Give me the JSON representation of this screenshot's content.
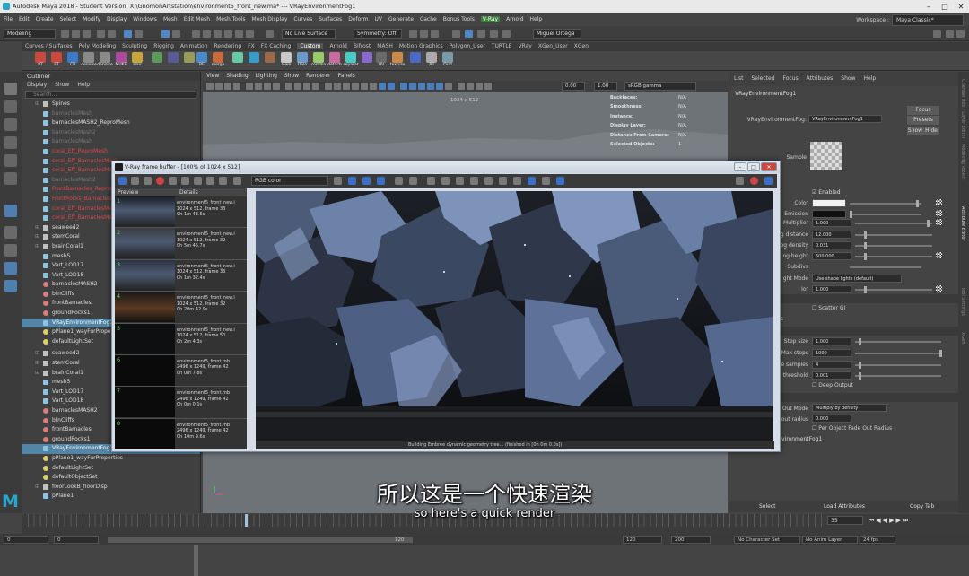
{
  "window": {
    "title": "Autodesk Maya 2018 - Student Version: X:\\GnomonArtstation\\environment5_front_new.ma* --- VRayEnvironmentFog1",
    "controls": [
      "–",
      "□",
      "✕"
    ]
  },
  "menubar": {
    "items": [
      "File",
      "Edit",
      "Create",
      "Select",
      "Modify",
      "Display",
      "Windows",
      "Mesh",
      "Edit Mesh",
      "Mesh Tools",
      "Mesh Display",
      "Curves",
      "Surfaces",
      "Deform",
      "UV",
      "Generate",
      "Cache",
      "Bonus Tools",
      "V-Ray",
      "Arnold",
      "Help"
    ],
    "workspace_label": "Workspace :",
    "workspace_value": "Maya Classic*"
  },
  "statusline": {
    "mode": "Modeling",
    "live_surface": "No Live Surface",
    "symmetry": "Symmetry: Off",
    "user": "Miguel Ortega"
  },
  "shelf": {
    "tabs": [
      "Curves / Surfaces",
      "Poly Modeling",
      "Sculpting",
      "Rigging",
      "Animation",
      "Rendering",
      "FX",
      "FX Caching",
      "Custom",
      "Arnold",
      "Bifrost",
      "MASH",
      "Motion Graphics",
      "Polygon_User",
      "TURTLE",
      "VRay",
      "XGen_User",
      "XGen"
    ],
    "active_tab": "Custom",
    "buttons": [
      "RT",
      "FT",
      "CP",
      "denoise",
      "denoise",
      "MUKE",
      "Hair",
      "",
      "",
      "",
      "BE",
      "merge",
      "",
      "",
      "",
      "lowe",
      "DSlo",
      "combin",
      "detach",
      "separat",
      "",
      "UV",
      "texture",
      "",
      "All",
      "Outl"
    ]
  },
  "outliner": {
    "title": "Outliner",
    "menu": [
      "Display",
      "Show",
      "Help"
    ],
    "search_placeholder": "Search...",
    "items": [
      {
        "label": "Spines",
        "style": "normal",
        "icon": "grp"
      },
      {
        "label": "barnaclesMash",
        "style": "dim",
        "icon": "mesh"
      },
      {
        "label": "barnaclesMASH2_ReproMesh",
        "style": "normal",
        "icon": "mesh"
      },
      {
        "label": "barnaclesMash2",
        "style": "dim",
        "icon": "mesh"
      },
      {
        "label": "barnaclesMash",
        "style": "dim",
        "icon": "mesh"
      },
      {
        "label": "coral_Eff_ReproMesh",
        "style": "red",
        "icon": "mesh"
      },
      {
        "label": "coral_Eff_BarnaclesMash",
        "style": "red",
        "icon": "mesh"
      },
      {
        "label": "coral_Eff_BarnaclesMash",
        "style": "red",
        "icon": "mesh"
      },
      {
        "label": "barnaclesMash2",
        "style": "dim",
        "icon": "mesh"
      },
      {
        "label": "FrontBarnacles_ReproMesh",
        "style": "red",
        "icon": "mesh"
      },
      {
        "label": "FrontRocks_BarnaclesMesh",
        "style": "red",
        "icon": "mesh"
      },
      {
        "label": "coral_Eff_BarnaclesMesh",
        "style": "red",
        "icon": "mesh"
      },
      {
        "label": "coral_Eff_BarnaclesMesh",
        "style": "red",
        "icon": "mesh"
      },
      {
        "label": "seaweed2",
        "style": "normal",
        "icon": "grp"
      },
      {
        "label": "stemCoral",
        "style": "normal",
        "icon": "grp"
      },
      {
        "label": "brainCoral1",
        "style": "normal",
        "icon": "grp"
      },
      {
        "label": "mesh5",
        "style": "normal",
        "icon": "mesh"
      },
      {
        "label": "Vart_LOD17",
        "style": "normal",
        "icon": "mesh"
      },
      {
        "label": "Vart_LOD18",
        "style": "normal",
        "icon": "mesh"
      },
      {
        "label": "barnaclesMASH2",
        "style": "normal",
        "icon": "sg"
      },
      {
        "label": "btnCliffs",
        "style": "normal",
        "icon": "sg"
      },
      {
        "label": "frontBarnacles",
        "style": "normal",
        "icon": "sg"
      },
      {
        "label": "groundRocks1",
        "style": "normal",
        "icon": "sg"
      },
      {
        "label": "VRayEnvironmentFog1",
        "style": "sel",
        "icon": "mesh"
      },
      {
        "label": "pPlane1_wayFurPropertie",
        "style": "normal",
        "icon": "light"
      },
      {
        "label": "defaultLightSet",
        "style": "normal",
        "icon": "light"
      }
    ],
    "items2": [
      {
        "label": "seaweed2",
        "style": "normal",
        "icon": "grp"
      },
      {
        "label": "stemCoral",
        "style": "normal",
        "icon": "grp"
      },
      {
        "label": "brainCoral1",
        "style": "normal",
        "icon": "grp"
      },
      {
        "label": "mesh5",
        "style": "normal",
        "icon": "mesh"
      },
      {
        "label": "Vart_LOD17",
        "style": "normal",
        "icon": "mesh"
      },
      {
        "label": "Vart_LOD18",
        "style": "normal",
        "icon": "mesh"
      },
      {
        "label": "barnaclesMASH2",
        "style": "normal",
        "icon": "sg"
      },
      {
        "label": "btnCliffs",
        "style": "normal",
        "icon": "sg"
      },
      {
        "label": "frontBarnacles",
        "style": "normal",
        "icon": "sg"
      },
      {
        "label": "groundRocks1",
        "style": "normal",
        "icon": "sg"
      },
      {
        "label": "VRayEnvironmentFog1",
        "style": "sel",
        "icon": "mesh"
      },
      {
        "label": "pPlane1_wayFurProperties",
        "style": "normal",
        "icon": "light"
      },
      {
        "label": "defaultLightSet",
        "style": "normal",
        "icon": "light"
      },
      {
        "label": "defaultObjectSet",
        "style": "normal",
        "icon": "light"
      },
      {
        "label": "floorLookB_floorDisp",
        "style": "normal",
        "icon": "grp"
      },
      {
        "label": "pPlane1",
        "style": "normal",
        "icon": "mesh"
      }
    ]
  },
  "viewport": {
    "menu": [
      "View",
      "Shading",
      "Lighting",
      "Show",
      "Renderer",
      "Panels"
    ],
    "field1": "0.00",
    "field2": "1.00",
    "colorspace": "sRGB gamma",
    "resolution": "1024 x 512",
    "hud": [
      {
        "k": "Backfaces:",
        "v": "N/A"
      },
      {
        "k": "Smoothness:",
        "v": "N/A"
      },
      {
        "k": "Instance:",
        "v": "N/A"
      },
      {
        "k": "Display Layer:",
        "v": "N/A"
      },
      {
        "k": "Distance From Camera:",
        "v": "N/A"
      },
      {
        "k": "Selected Objects:",
        "v": "1"
      }
    ]
  },
  "vfb": {
    "title": "V-Ray frame buffer - [100% of 1024 x 512]",
    "channel": "RGB color",
    "history_headers": [
      "Preview",
      "Details"
    ],
    "history": [
      {
        "num": "1",
        "name": "environment5_front_new.i",
        "size": "1024 x 512, frame 33",
        "time": "0h 1m 43.6s"
      },
      {
        "num": "2",
        "name": "environment5_front_new.i",
        "size": "1024 x 512, frame 32",
        "time": "0h 5m 45.7s"
      },
      {
        "num": "3",
        "name": "environment5_front_new.i",
        "size": "1024 x 512, frame 33",
        "time": "0h 1m 32.4s"
      },
      {
        "num": "4",
        "name": "environment5_front_new.i",
        "size": "1024 x 512, frame 32",
        "time": "0h 20m 42.9s"
      },
      {
        "num": "5",
        "name": "environment5_front_new.i",
        "size": "1024 x 512, frame 50",
        "time": "0h 2m 4.3s"
      },
      {
        "num": "6",
        "name": "environment5_front.mb",
        "size": "2496 x 1249, frame 42",
        "time": "0h 0m 7.8s"
      },
      {
        "num": "7",
        "name": "environment5_front.mb",
        "size": "2496 x 1249, frame 42",
        "time": "0h 0m 0.1s"
      },
      {
        "num": "8",
        "name": "environment5_front.mb",
        "size": "2496 x 1249, frame 42",
        "time": "0h 10m 9.6s"
      }
    ],
    "status": "Building Embree dynamic geometry tree... (finished in [0h 0m 0.0s])"
  },
  "attr": {
    "menu": [
      "List",
      "Selected",
      "Focus",
      "Attributes",
      "Show",
      "Help"
    ],
    "node_tab": "VRayEnvironmentFog1",
    "node_label": "VRayEnvironmentFog:",
    "node_value": "VRayEnvironmentFog1",
    "focus_btn": "Focus",
    "presets_btn": "Presets",
    "show_btn": "Show",
    "hide_btn": "Hide",
    "sample_label": "Sample",
    "enabled_label": "Enabled",
    "rows": [
      {
        "label": "Color",
        "value": ""
      },
      {
        "label": "Emission",
        "value": ""
      },
      {
        "label": "Multiplier",
        "value": "1.000"
      },
      {
        "label": "og distance",
        "value": "12.000"
      },
      {
        "label": "og density",
        "value": "0.031"
      },
      {
        "label": "og height",
        "value": "600.000"
      },
      {
        "label": "Subdivs",
        "value": ""
      },
      {
        "label": "ght Mode",
        "value": "Use shape lights (default)"
      },
      {
        "label": "Ior",
        "value": "1.000"
      }
    ],
    "scatter_gi": "Scatter GI",
    "bounces_label": "bounces",
    "rows2": [
      {
        "label": "Step size",
        "value": "1.000"
      },
      {
        "label": "Max steps",
        "value": "1000"
      },
      {
        "label": "ance samples",
        "value": "4"
      },
      {
        "label": "threshold",
        "value": "0.001"
      }
    ],
    "deep_output": "Deep Output",
    "fade_mode_label": "Out Mode",
    "fade_mode_value": "Multiply by density",
    "fade_radius_label": "out radius",
    "fade_radius_value": "0.000",
    "per_object": "Per Object Fade Out Radius",
    "footer_node": "vironmentFog1",
    "bottom": [
      "Select",
      "Load Attributes",
      "Copy Tab"
    ],
    "side_tabs": [
      "Channel Box / Layer Editor",
      "Modeling Toolkit",
      "Attribute Editor",
      "Tool Settings",
      "XGen"
    ]
  },
  "timeline": {
    "current_frame": "35",
    "start": "0",
    "range_start": "0",
    "range_end": "120",
    "end": "120",
    "end2": "200",
    "char_set": "No Character Set",
    "anim_layer": "No Anim Layer",
    "fps": "24 fps"
  },
  "subtitle": {
    "zh": "所以这是一个快速渲染",
    "en": "so here's a quick render"
  }
}
